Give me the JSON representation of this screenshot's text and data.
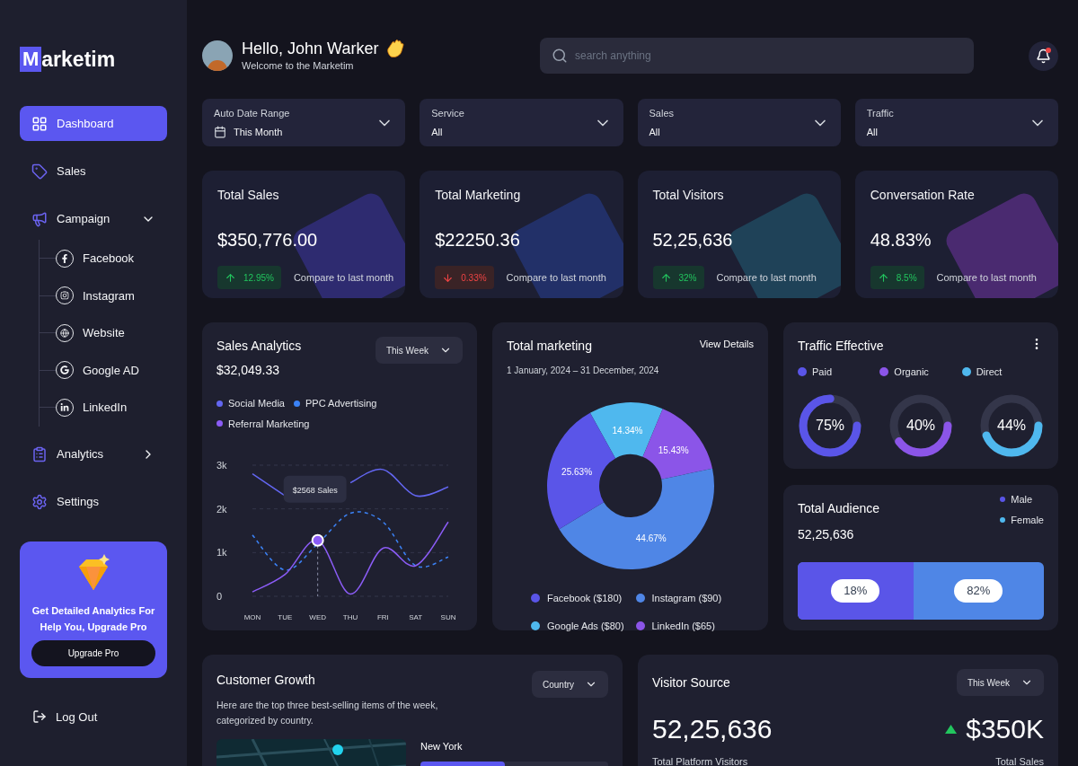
{
  "brand": {
    "initial": "M",
    "rest": "arketim"
  },
  "nav": [
    {
      "label": "Dashboard",
      "selected": true
    },
    {
      "label": "Sales",
      "selected": false
    },
    {
      "label": "Campaign",
      "selected": false,
      "expanded": true,
      "children": [
        {
          "label": "Facebook"
        },
        {
          "label": "Instagram"
        },
        {
          "label": "Website"
        },
        {
          "label": "Google AD"
        },
        {
          "label": "LinkedIn"
        }
      ]
    },
    {
      "label": "Analytics",
      "selected": false,
      "expanded": false
    },
    {
      "label": "Settings",
      "selected": false
    }
  ],
  "promo": {
    "text": "Get Detailed Analytics For Help You, Upgrade Pro",
    "button": "Upgrade Pro"
  },
  "logout": "Log Out",
  "header": {
    "greeting": "Hello, John Warker",
    "subtitle": "Welcome to the Marketim"
  },
  "search": {
    "placeholder": "search anything"
  },
  "notifications": {
    "unread": true
  },
  "filters": [
    {
      "label": "Auto Date Range",
      "value": "This Month",
      "kind": "date"
    },
    {
      "label": "Service",
      "value": "All",
      "kind": "plain"
    },
    {
      "label": "Sales",
      "value": "All",
      "kind": "plain"
    },
    {
      "label": "Traffic",
      "value": "All",
      "kind": "plain"
    }
  ],
  "stats": [
    {
      "title": "Total Sales",
      "value": "$350,776.00",
      "change": "12.95%",
      "rising": true,
      "compare": "Compare to last month",
      "color": "#2e2b70"
    },
    {
      "title": "Total Marketing",
      "value": "$22250.36",
      "change": "0.33%",
      "rising": false,
      "compare": "Compare to last month",
      "color": "#223068"
    },
    {
      "title": "Total Visitors",
      "value": "52,25,636",
      "change": "32%",
      "rising": true,
      "compare": "Compare to last month",
      "color": "#1f4258"
    },
    {
      "title": "Conversation Rate",
      "value": "48.83%",
      "change": "8.5%",
      "rising": true,
      "compare": "Compare to last month",
      "color": "#4a2a70"
    }
  ],
  "sales_analytics": {
    "title": "Sales Analytics",
    "total": "$32,049.33",
    "period": "This Week",
    "tooltip": "$2568 Sales",
    "chart_data": {
      "type": "line",
      "categories": [
        "MON",
        "TUE",
        "WED",
        "THU",
        "FRI",
        "SAT",
        "SUN"
      ],
      "yticks": [
        {
          "value": 0,
          "label": "0"
        },
        {
          "value": 1000,
          "label": "1k"
        },
        {
          "value": 2000,
          "label": "2k"
        },
        {
          "value": 3000,
          "label": "3k"
        }
      ],
      "ylim": [
        0,
        3000
      ],
      "ref_lines": [
        {
          "axis": "x",
          "value": "WED"
        }
      ],
      "series": [
        {
          "name": "Social Media",
          "color": "#6366f1",
          "values": [
            2800,
            2300,
            null,
            2600,
            2900,
            2300,
            2500
          ]
        },
        {
          "name": "PPC Advertising",
          "color": "#3b82f6",
          "line_style": "dashed",
          "values": [
            1400,
            600,
            1200,
            1900,
            1700,
            700,
            900
          ]
        },
        {
          "name": "Referral Marketing",
          "color": "#8b5cf6",
          "values": [
            100,
            500,
            1280,
            50,
            1100,
            700,
            1700
          ]
        }
      ]
    }
  },
  "total_marketing": {
    "title": "Total marketing",
    "link": "View Details",
    "range": "1 January, 2024 – 31 December, 2024",
    "chart_data": {
      "type": "donut",
      "categories": [
        "Facebook ($180)",
        "Instagram ($90)",
        "Google Ads ($80)",
        "LinkedIn ($65)"
      ],
      "values": [
        25.63,
        44.67,
        14.34,
        15.43
      ],
      "value_labels": [
        "25.63%",
        "44.67%",
        "14.34%",
        "15.43%"
      ],
      "colors": [
        "#5a55e8",
        "#4f86e6",
        "#4fb8ee",
        "#8b55e8"
      ]
    }
  },
  "traffic": {
    "title": "Traffic Effective",
    "items": [
      {
        "label": "Paid",
        "color": "#5a55e8",
        "level": 0.75,
        "reading": "75%"
      },
      {
        "label": "Organic",
        "color": "#8b55e8",
        "level": 0.4,
        "reading": "40%"
      },
      {
        "label": "Direct",
        "color": "#4fb8ee",
        "level": 0.44,
        "reading": "44%"
      }
    ]
  },
  "audience": {
    "title": "Total Audience",
    "total": "52,25,636",
    "legend": [
      {
        "label": "Male",
        "color": "#5a55e8"
      },
      {
        "label": "Female",
        "color": "#4fb8ee"
      }
    ],
    "bar": {
      "level": 0.47
    },
    "male_reading": "18%",
    "female_reading": "82%"
  },
  "customer_growth": {
    "title": "Customer Growth",
    "filter": "Country",
    "description": "Here are the top three best-selling items of the week, categorized by country.",
    "city": "New York",
    "city_bar": {
      "level": 0.45
    }
  },
  "visitor_source": {
    "title": "Visitor Source",
    "period": "This Week",
    "visitors": "52,25,636",
    "visitors_label": "Total Platform Visitors",
    "sales": "$350K",
    "sales_rising": true,
    "sales_label": "Total Sales"
  }
}
